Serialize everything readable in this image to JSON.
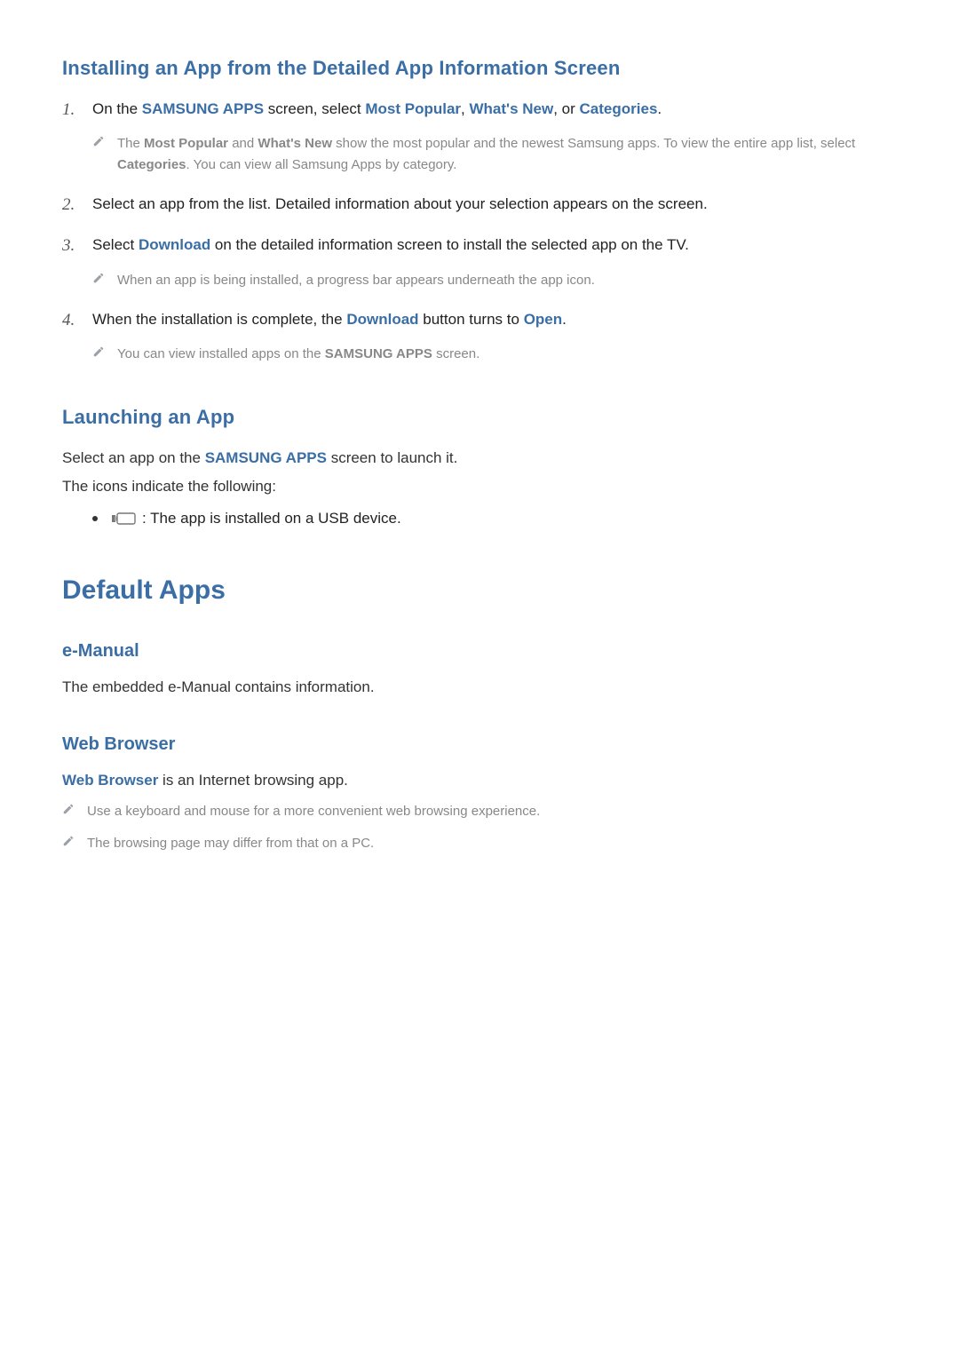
{
  "section1": {
    "heading": "Installing an App from the Detailed App Information Screen",
    "items": [
      {
        "num": "1.",
        "pre": "On the ",
        "b1": "SAMSUNG APPS",
        "mid1": " screen, select ",
        "b2": "Most Popular",
        "mid2": ", ",
        "b3": "What's New",
        "mid3": ", or ",
        "b4": "Categories",
        "post": ".",
        "note_pre": "The ",
        "note_b1": "Most Popular",
        "note_mid1": " and ",
        "note_b2": "What's New",
        "note_mid2": " show the most popular and the newest Samsung apps. To view the entire app list, select ",
        "note_b3": "Categories",
        "note_post": ". You can view all Samsung Apps by category."
      },
      {
        "num": "2.",
        "text": "Select an app from the list. Detailed information about your selection appears on the screen."
      },
      {
        "num": "3.",
        "pre": "Select ",
        "b1": "Download",
        "post": " on the detailed information screen to install the selected app on the TV.",
        "note": "When an app is being installed, a progress bar appears underneath the app icon."
      },
      {
        "num": "4.",
        "pre": "When the installation is complete, the ",
        "b1": "Download",
        "mid1": " button turns to ",
        "b2": "Open",
        "post": ".",
        "note_pre": "You can view installed apps on the ",
        "note_b1": "SAMSUNG APPS",
        "note_post": " screen."
      }
    ]
  },
  "section2": {
    "heading": "Launching an App",
    "line1_pre": "Select an app on the ",
    "line1_b": "SAMSUNG APPS",
    "line1_post": " screen to launch it.",
    "line2": "The icons indicate the following:",
    "bullet_text": " : The app is installed on a USB device."
  },
  "main_heading": "Default Apps",
  "emanual": {
    "heading": "e-Manual",
    "text": "The embedded e-Manual contains information."
  },
  "webbrowser": {
    "heading": "Web Browser",
    "line_b": "Web Browser",
    "line_rest": " is an Internet browsing app.",
    "note1": "Use a keyboard and mouse for a more convenient web browsing experience.",
    "note2": "The browsing page may differ from that on a PC."
  }
}
